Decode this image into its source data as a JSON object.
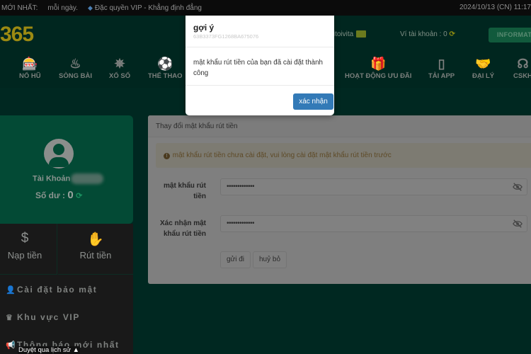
{
  "topbar": {
    "ticker_label": "MỚI NHẤT:",
    "ticker_text1": "mỗi ngày.",
    "ticker_gem_icon": "diamond-icon",
    "ticker_text2": "Đặc quyền VIP - Khẳng định đẳng",
    "datetime": "2024/10/13 (CN) 11:17"
  },
  "header": {
    "logo": "365",
    "user_label": "n : vitoivita",
    "wallet_label": "Ví tài khoản : 0",
    "info_button": "INFORMATI"
  },
  "nav": {
    "items": [
      {
        "label": "NỔ HŨ",
        "icon": "slot-machine-icon"
      },
      {
        "label": "SÒNG BÀI",
        "icon": "roulette-icon"
      },
      {
        "label": "XỔ SỐ",
        "icon": "lottery-wheel-icon"
      },
      {
        "label": "THỂ THAO",
        "icon": "soccer-ball-icon"
      },
      {
        "label": "HOẠT ĐỘNG ƯU ĐÃI",
        "icon": "gift-icon"
      },
      {
        "label": "TẢI APP",
        "icon": "phone-icon"
      },
      {
        "label": "ĐẠI LÝ",
        "icon": "handshake-icon"
      },
      {
        "label": "CSKH",
        "icon": "headset-icon"
      }
    ]
  },
  "profile": {
    "account_label": "Tài Khoản",
    "balance_label": "Số dư :",
    "balance_value": "0"
  },
  "sidebar": {
    "deposit": "Nạp tiền",
    "withdraw": "Rút tiền",
    "menu": [
      {
        "label": "Cài đặt bảo mật",
        "icon": "user-lock-icon"
      },
      {
        "label": "Khu vực VIP",
        "icon": "vip-crown-icon"
      },
      {
        "label": "Thông báo mới nhất",
        "icon": "megaphone-icon"
      }
    ],
    "tooltip": "Duyệt qua lịch sử"
  },
  "panel": {
    "title": "Thay đổi mật khẩu rút tiền",
    "alert": "mật khẩu rút tiền chưa cài đặt, vui lòng cài đặt mật khẩu rút tiền trước",
    "fields": [
      {
        "label_line1": "mật khẩu rút",
        "label_line2": "tiền",
        "value": "•••••••••••••"
      },
      {
        "label_line1": "Xác nhận mật",
        "label_line2": "khẩu rút tiền",
        "value": "•••••••••••••"
      }
    ],
    "submit": "gửi đi",
    "cancel": "huỷ bỏ"
  },
  "modal": {
    "title": "gợi ý",
    "subtitle": "63B3373FG1268BA675076",
    "message": "mật khẩu rút tiền của bạn đã cài đặt thành công",
    "confirm": "xác nhận"
  },
  "colors": {
    "background": "#002821",
    "logo": "#9c8a12",
    "profile_card": "#034a35",
    "primary_button": "#337ab7"
  }
}
